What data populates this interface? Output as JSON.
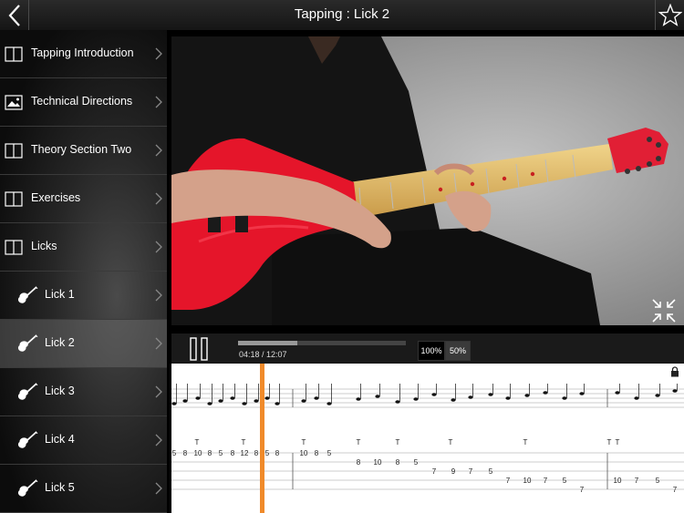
{
  "header": {
    "title": "Tapping : Lick 2"
  },
  "sidebar": {
    "items": [
      {
        "label": "Tapping Introduction",
        "icon": "book-icon"
      },
      {
        "label": "Technical Directions",
        "icon": "image-icon"
      },
      {
        "label": "Theory Section Two",
        "icon": "book-icon"
      },
      {
        "label": "Exercises",
        "icon": "book-icon"
      },
      {
        "label": "Licks",
        "icon": "book-icon"
      },
      {
        "label": "Lick 1",
        "icon": "guitar-icon"
      },
      {
        "label": "Lick 2",
        "icon": "guitar-icon"
      },
      {
        "label": "Lick 3",
        "icon": "guitar-icon"
      },
      {
        "label": "Lick 4",
        "icon": "guitar-icon"
      },
      {
        "label": "Lick 5",
        "icon": "guitar-icon"
      }
    ]
  },
  "player": {
    "time": "04:18 / 12:07",
    "progress": 0.355,
    "speed_100": "100%",
    "speed_50": "50%",
    "selected_speed": "100%"
  },
  "tab": {
    "fret_numbers": [
      {
        "text": "5",
        "s": 0
      },
      {
        "text": "8",
        "s": 0
      },
      {
        "text": "10",
        "s": 0
      },
      {
        "text": "8",
        "s": 0
      },
      {
        "text": "5",
        "s": 0
      },
      {
        "text": "8",
        "s": 0
      },
      {
        "text": "12",
        "s": 0
      },
      {
        "text": "8",
        "s": 0
      },
      {
        "text": "5",
        "s": 0
      },
      {
        "text": "8",
        "s": 0
      },
      {
        "text": "10",
        "s": 0
      },
      {
        "text": "8",
        "s": 0
      },
      {
        "text": "5",
        "s": 0
      },
      {
        "text": "8",
        "s": 1
      },
      {
        "text": "10",
        "s": 1
      },
      {
        "text": "8",
        "s": 1
      },
      {
        "text": "5",
        "s": 1
      },
      {
        "text": "7",
        "s": 2
      },
      {
        "text": "9",
        "s": 2
      },
      {
        "text": "7",
        "s": 2
      },
      {
        "text": "5",
        "s": 2
      },
      {
        "text": "7",
        "s": 3
      },
      {
        "text": "10",
        "s": 3
      },
      {
        "text": "7",
        "s": 3
      },
      {
        "text": "5",
        "s": 3
      },
      {
        "text": "7",
        "s": 4
      },
      {
        "text": "10",
        "s": 3
      },
      {
        "text": "7",
        "s": 3
      },
      {
        "text": "5",
        "s": 3
      },
      {
        "text": "7",
        "s": 4
      }
    ],
    "tap_marks": [
      "T",
      "T",
      "T",
      "T",
      "T",
      "T",
      "T",
      "T",
      "T"
    ]
  }
}
